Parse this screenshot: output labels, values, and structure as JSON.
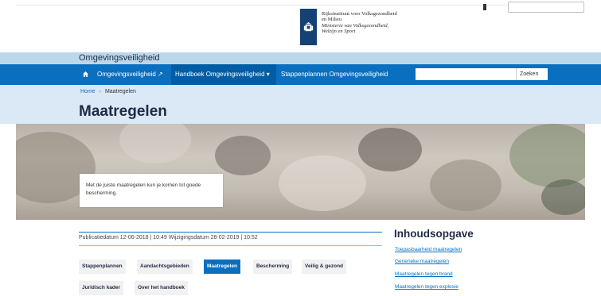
{
  "header": {
    "logo_lines": [
      "Rijksinstituut voor Volksgezondheid",
      "en Milieu",
      "Ministerie van Volksgezondheid,",
      "Welzijn en Sport"
    ]
  },
  "site": {
    "title": "Omgevingsveiligheid"
  },
  "nav": {
    "items": [
      {
        "label": "Omgevingsveiligheid ↗"
      },
      {
        "label": "Handboek Omgevingsveiligheid ▾"
      },
      {
        "label": "Stappenplannen Omgevingsveiligheid"
      }
    ],
    "search": {
      "placeholder": "",
      "button_label": "Zoeken"
    }
  },
  "breadcrumb": {
    "home": "Home",
    "separator": "›",
    "current": "Maatregelen"
  },
  "page": {
    "title": "Maatregelen",
    "hero_caption": "Met de juiste maatregelen kun je komen tot goede bescherming."
  },
  "meta": {
    "text": "Publicatiedatum 12-06-2018 | 10:49    Wijzigingsdatum 28-02-2019 | 10:52"
  },
  "tags": [
    {
      "label": "Stappenplannen",
      "active": false
    },
    {
      "label": "Aandachtsgebieden",
      "active": false
    },
    {
      "label": "Maatregelen",
      "active": true
    },
    {
      "label": "Bescherming",
      "active": false
    },
    {
      "label": "Veilig & gezond",
      "active": false
    },
    {
      "label": "Juridisch kader",
      "active": false
    },
    {
      "label": "Over het handboek",
      "active": false
    }
  ],
  "toc": {
    "title": "Inhoudsopgave",
    "links": [
      "Toepasbaarheid maatregelen",
      "Generieke maatregelen",
      "Maatregelen tegen brand",
      "Maatregelen tegen explosie"
    ]
  },
  "colors": {
    "nav_blue": "#0a6fbf",
    "site_bar": "#bcd6ea",
    "title_area": "#dbe9f6",
    "logo_blue": "#154273"
  }
}
